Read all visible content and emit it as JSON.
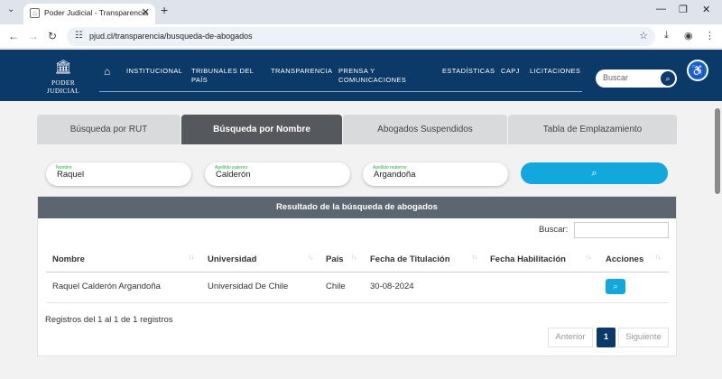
{
  "browser": {
    "tab_title": "Poder Judicial - Transparencia",
    "url": "pjud.cl/transparencia/busqueda-de-abogados"
  },
  "header": {
    "logo_text": "PODER JUDICIAL",
    "nav": [
      "INSTITUCIONAL",
      "TRIBUNALES DEL PAÍS",
      "TRANSPARENCIA",
      "PRENSA Y COMUNICACIONES",
      "ESTADÍSTICAS",
      "CAPJ",
      "LICITACIONES"
    ],
    "search_placeholder": "Buscar"
  },
  "tabs": [
    "Búsqueda por RUT",
    "Búsqueda por Nombre",
    "Abogados Suspendidos",
    "Tabla de Emplazamiento"
  ],
  "active_tab": "Búsqueda por Nombre",
  "fields": [
    {
      "label": "Nombre",
      "value": "Raquel"
    },
    {
      "label": "Apellido paterno",
      "value": "Calderón"
    },
    {
      "label": "Apellido materno",
      "value": "Argandoña"
    }
  ],
  "results": {
    "title": "Resultado de la búsqueda de abogados",
    "filter_label": "Buscar:",
    "columns": [
      "Nombre",
      "Universidad",
      "País",
      "Fecha de Titulación",
      "Fecha Habilitación",
      "Acciones"
    ],
    "rows": [
      {
        "nombre": "Raquel Calderón Argandoña",
        "universidad": "Universidad De Chile",
        "pais": "Chile",
        "fecha_titulacion": "30-08-2024",
        "fecha_habilitacion": ""
      }
    ],
    "info": "Registros del 1 al 1 de 1 registros",
    "pager": {
      "prev": "Anterior",
      "current": "1",
      "next": "Siguiente"
    }
  },
  "colors": {
    "header_bg": "#0b3a68",
    "accent": "#13a8dd",
    "active_tab": "#55595d",
    "results_head": "#5b6670"
  }
}
